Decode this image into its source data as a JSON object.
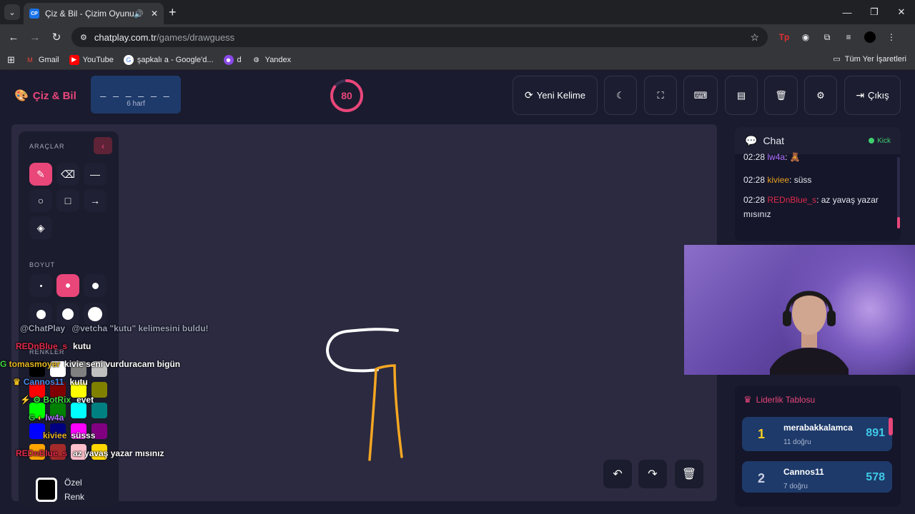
{
  "browser": {
    "tab_title": "Çiz & Bil - Çizim Oyunu",
    "tab_favicon": "CP",
    "url_host": "chatplay.com.tr",
    "url_path": "/games/drawguess",
    "bookmarks": [
      {
        "label": "Gmail",
        "icon": "gmail-icon"
      },
      {
        "label": "YouTube",
        "icon": "youtube-icon"
      },
      {
        "label": "şapkalı a - Google'd...",
        "icon": "google-icon"
      },
      {
        "label": "d",
        "icon": "twitch-icon"
      },
      {
        "label": "Yandex",
        "icon": "globe-icon"
      }
    ],
    "all_bookmarks": "Tüm Yer İşaretleri"
  },
  "app": {
    "logo": "Çiz & Bil",
    "word_dashes": "_ _ _ _ _ _",
    "word_hint": "6 harf",
    "timer": "80",
    "timer_fraction": 0.85,
    "buttons": {
      "new_word": "Yeni Kelime",
      "exit": "Çıkış"
    },
    "accent": "#e9467a"
  },
  "tools": {
    "title": "ARAÇLAR",
    "size_title": "BOYUT",
    "colors_title": "RENKLER",
    "custom_color": "Özel Renk",
    "palette": [
      "#000000",
      "#ffffff",
      "#808080",
      "#c0c0c0",
      "#ff0000",
      "#800000",
      "#ffff00",
      "#808000",
      "#00ff00",
      "#008000",
      "#00ffff",
      "#008080",
      "#0000ff",
      "#000080",
      "#ff00ff",
      "#800080",
      "#ffa500",
      "#a52a2a",
      "#ffc0cb",
      "#ffd700"
    ]
  },
  "overlay_chat": [
    {
      "user": "@ChatPlay",
      "text": "@vetcha \"kutu\" kelimesini buldu!",
      "color": "#9aa0b8"
    },
    {
      "user": "REDnBlue_s",
      "text": "kutu",
      "color": "#e02a4a"
    },
    {
      "user": "tomasmoyer",
      "text": "kivie seni vurduracam bigün",
      "color": "#e8b820"
    },
    {
      "user": "Cannos11",
      "text": "kutu",
      "color": "#4a8ae8"
    },
    {
      "user": "BotRix",
      "text": "evet",
      "color": "#3fd83f"
    },
    {
      "user": "lw4a",
      "text": "",
      "color": "#b070ff"
    },
    {
      "user": "kiviee",
      "text": "süsss",
      "color": "#e8b820"
    },
    {
      "user": "REDnBlue_s",
      "text": "az yavaş yazar mısınız",
      "color": "#e02a4a"
    }
  ],
  "chat": {
    "title": "Chat",
    "status": "Kick",
    "messages": [
      {
        "time": "02:28",
        "user": "lw4a",
        "text": ":",
        "color": "#b070ff"
      },
      {
        "time": "02:28",
        "user": "kiviee",
        "text": ": süss",
        "color": "#e8a020"
      },
      {
        "time": "02:28",
        "user": "REDnBlue_s",
        "text": ": az yavaş yazar mısınız",
        "color": "#e02a4a"
      }
    ]
  },
  "leaderboard": {
    "title": "Liderlik Tablosu",
    "rows": [
      {
        "rank": "1",
        "name": "merabakkalamca",
        "sub": "11 doğru",
        "score": "891",
        "rank_color": "#f5d020"
      },
      {
        "rank": "2",
        "name": "Cannos11",
        "sub": "7 doğru",
        "score": "578",
        "rank_color": "#c8cde0"
      }
    ]
  }
}
